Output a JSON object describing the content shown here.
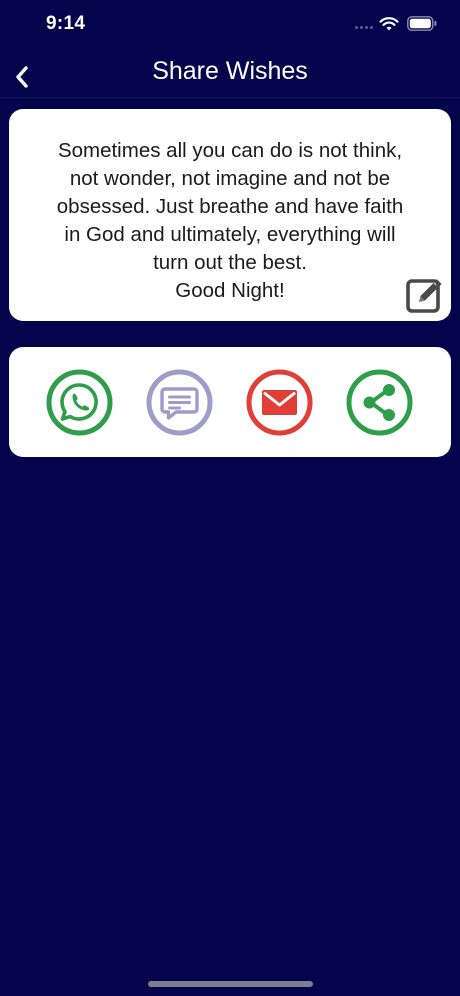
{
  "status_bar": {
    "time": "9:14"
  },
  "nav": {
    "title": "Share Wishes",
    "back_icon": "chevron-left-icon"
  },
  "message": {
    "text": "Sometimes all you can do is not think,\nnot wonder, not imagine and not be\nobsessed. Just breathe and have faith\nin God and ultimately, everything will\nturn out the best.\nGood Night!",
    "edit_icon": "edit-icon"
  },
  "share": {
    "buttons": [
      {
        "id": "whatsapp",
        "icon": "whatsapp-icon",
        "color": "#2e9e4a"
      },
      {
        "id": "message",
        "icon": "message-icon",
        "color": "#a09cc8"
      },
      {
        "id": "email",
        "icon": "email-icon",
        "color": "#e03e36"
      },
      {
        "id": "share",
        "icon": "share-icon",
        "color": "#2e9e4a"
      }
    ]
  },
  "colors": {
    "background": "#04044d",
    "card": "#ffffff",
    "whatsapp": "#2e9e4a",
    "message": "#a09cc8",
    "email": "#e03e36",
    "share": "#2e9e4a",
    "edit": "#4a4a4a"
  }
}
